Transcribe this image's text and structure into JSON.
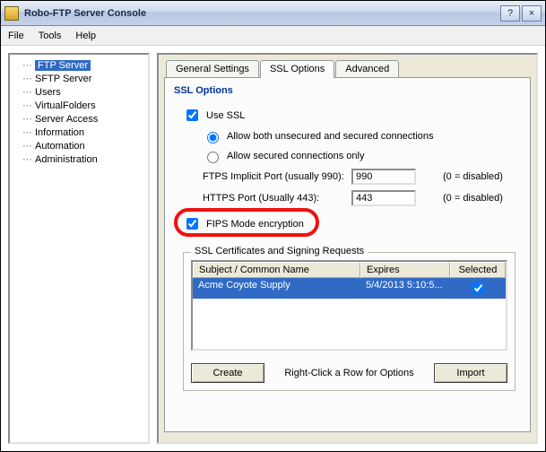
{
  "window": {
    "title": "Robo-FTP Server Console",
    "help_btn": "?",
    "close_btn": "×"
  },
  "menubar": [
    "File",
    "Tools",
    "Help"
  ],
  "tree": {
    "items": [
      "FTP Server",
      "SFTP Server",
      "Users",
      "VirtualFolders",
      "Server Access",
      "Information",
      "Automation",
      "Administration"
    ],
    "selected_index": 0
  },
  "tabs": {
    "items": [
      "General Settings",
      "SSL Options",
      "Advanced"
    ],
    "active_index": 1
  },
  "ssl": {
    "section_title": "SSL Options",
    "use_ssl_label": "Use SSL",
    "use_ssl_checked": true,
    "radio_both_label": "Allow both unsecured and secured connections",
    "radio_secured_label": "Allow secured connections only",
    "radio_selected": "both",
    "ftps_label": "FTPS Implicit Port (usually 990):",
    "ftps_value": "990",
    "https_label": "HTTPS Port (Usually 443):",
    "https_value": "443",
    "disabled_hint": "(0 = disabled)",
    "fips_label": "FIPS Mode encryption",
    "fips_checked": true
  },
  "certgroup": {
    "title": "SSL Certificates and Signing Requests",
    "columns": [
      "Subject / Common Name",
      "Expires",
      "Selected"
    ],
    "rows": [
      {
        "subject": "Acme Coyote Supply",
        "expires": "5/4/2013 5:10:5...",
        "selected": true
      }
    ],
    "create_btn": "Create",
    "import_btn": "Import",
    "hint": "Right-Click a Row for Options"
  }
}
